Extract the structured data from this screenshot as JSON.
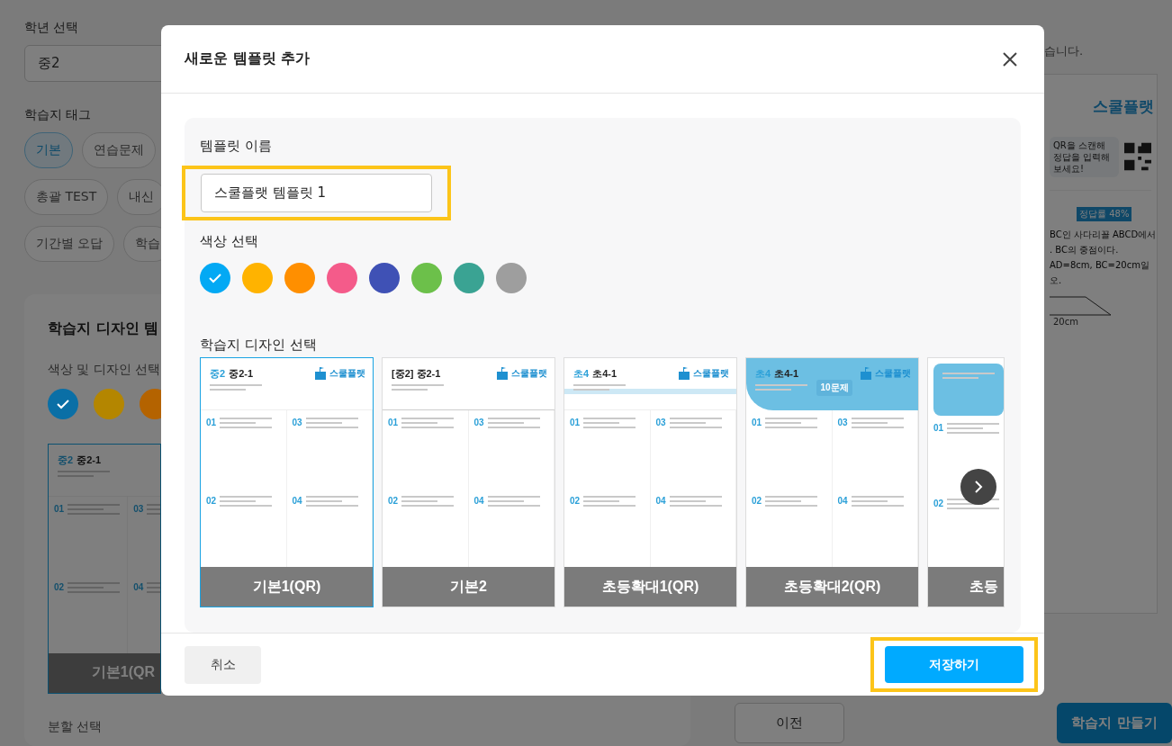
{
  "background": {
    "grade_label": "학년 선택",
    "grade_value": "중2",
    "tag_label": "학습지 태그",
    "tag_rows": [
      [
        {
          "label": "기본",
          "selected": true
        },
        {
          "label": "연습문제",
          "selected": false
        }
      ],
      [
        {
          "label": "총괄 TEST",
          "selected": false
        },
        {
          "label": "내신",
          "selected": false
        }
      ],
      [
        {
          "label": "기간별 오답",
          "selected": false
        },
        {
          "label": "학습",
          "selected": false
        }
      ]
    ],
    "template_title": "학습지 디자인 템",
    "color_label": "색상 및 디자인 선택",
    "colors": [
      {
        "color": "#0a6fa6",
        "selected": true
      },
      {
        "color": "#b48600",
        "selected": false
      },
      {
        "color": "#b46300",
        "selected": false
      }
    ],
    "template_card": {
      "kind": "plain",
      "tag": "중2",
      "title": "중2-1",
      "numbers": [
        "01",
        "02",
        "03",
        "04"
      ],
      "caption": "기본1(QR",
      "selected": true,
      "partial": true
    },
    "split_label": "분할 선택",
    "notice": "습니다.",
    "sheet": {
      "logo": "스쿨플랫",
      "qr_note": "QR을 스캔해 정답을 입력해 보세요!",
      "badge": "정답률 48%",
      "lines": [
        "BC인 사다리꼴 ABCD에서",
        ". BC의 중점이다.",
        "AD=8cm, BC=20cm일",
        "오."
      ],
      "figure_label": "20cm"
    },
    "buttons": [
      {
        "label": "이전",
        "kind": "secondary"
      },
      {
        "label": "학습지 만들기",
        "kind": "primary"
      }
    ]
  },
  "dialog": {
    "title": "새로운 템플릿 추가",
    "name_label": "템플릿 이름",
    "name_value": "스쿨플랫 템플릿 1",
    "name_highlighted": true,
    "color_label": "색상 선택",
    "colors": [
      {
        "color": "#03a9f4",
        "selected": true
      },
      {
        "color": "#ffb300",
        "selected": false
      },
      {
        "color": "#ff8f00",
        "selected": false
      },
      {
        "color": "#f45b8a",
        "selected": false
      },
      {
        "color": "#3f51b5",
        "selected": false
      },
      {
        "color": "#6cc04a",
        "selected": false
      },
      {
        "color": "#3aa393",
        "selected": false
      },
      {
        "color": "#9e9e9e",
        "selected": false
      }
    ],
    "design_label": "학습지 디자인 선택",
    "designs": [
      {
        "kind": "plain",
        "tag": "중2",
        "title": "중2-1",
        "logo": "스쿨플랫",
        "numbers": [
          "01",
          "02",
          "03",
          "04"
        ],
        "caption": "기본1(QR)",
        "selected": true,
        "partial": false
      },
      {
        "kind": "bracket",
        "title": "[중2] 중2-1",
        "logo": "스쿨플랫",
        "numbers": [
          "01",
          "02",
          "03",
          "04"
        ],
        "caption": "기본2",
        "selected": false,
        "partial": false
      },
      {
        "kind": "track",
        "tag": "초4",
        "title": "초4-1",
        "logo": "스쿨플랫",
        "numbers": [
          "01",
          "02",
          "03",
          "04"
        ],
        "caption": "초등확대1(QR)",
        "selected": false,
        "partial": false
      },
      {
        "kind": "wave",
        "tag": "초4",
        "title": "초4-1",
        "badge": "10문제",
        "logo": "스쿨플랫",
        "numbers": [
          "01",
          "02",
          "03",
          "04"
        ],
        "caption": "초등확대2(QR)",
        "selected": false,
        "partial": false
      },
      {
        "kind": "box",
        "numbers": [
          "01",
          "02"
        ],
        "caption": "초등",
        "selected": false,
        "partial": true
      }
    ],
    "cancel": "취소",
    "save": "저장하기",
    "save_highlighted": true
  }
}
